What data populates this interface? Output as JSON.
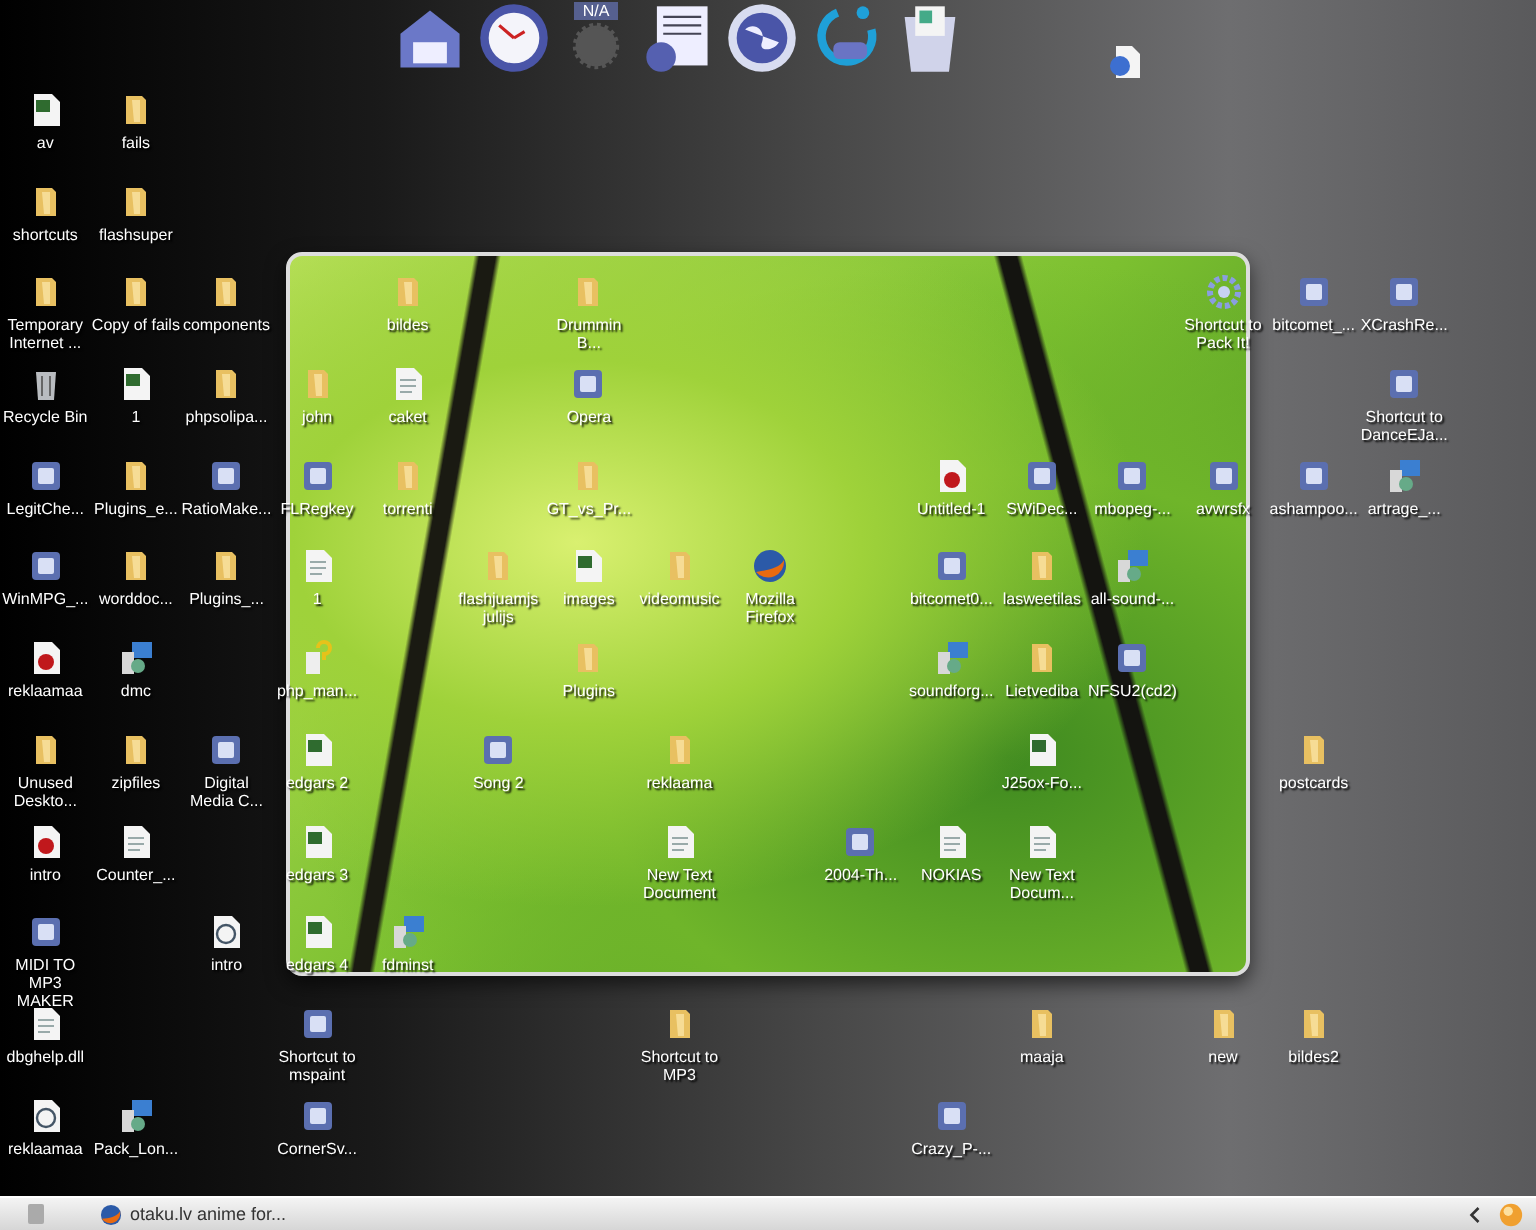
{
  "dock": {
    "badge": "N/A"
  },
  "icons": [
    {
      "label": "av",
      "kind": "sheet"
    },
    {
      "label": "fails",
      "kind": "folder"
    },
    {
      "label": "shortcuts",
      "kind": "folder"
    },
    {
      "label": "flashsuper",
      "kind": "folder"
    },
    {
      "label": "Temporary Internet ...",
      "kind": "folder"
    },
    {
      "label": "Copy of fails",
      "kind": "folder"
    },
    {
      "label": "components",
      "kind": "folder"
    },
    {
      "label": "bildes",
      "kind": "folder"
    },
    {
      "label": "Drummin B...",
      "kind": "folder"
    },
    {
      "label": "Shortcut to Pack It!",
      "kind": "gear"
    },
    {
      "label": "bitcomet_...",
      "kind": "program"
    },
    {
      "label": "XCrashRe...",
      "kind": "program"
    },
    {
      "label": "Recycle Bin",
      "kind": "recycle"
    },
    {
      "label": "1",
      "kind": "sheet"
    },
    {
      "label": "phpsolipa...",
      "kind": "folder"
    },
    {
      "label": "john",
      "kind": "folder"
    },
    {
      "label": "caket",
      "kind": "document"
    },
    {
      "label": "Opera",
      "kind": "program"
    },
    {
      "label": "Shortcut to DanceEJa...",
      "kind": "program"
    },
    {
      "label": "LegitChe...",
      "kind": "program"
    },
    {
      "label": "Plugins_e...",
      "kind": "folder"
    },
    {
      "label": "RatioMake...",
      "kind": "program"
    },
    {
      "label": "FLRegkey",
      "kind": "program"
    },
    {
      "label": "torrenti",
      "kind": "folder"
    },
    {
      "label": "GT_vs_Pr...",
      "kind": "folder"
    },
    {
      "label": "Untitled-1",
      "kind": "media"
    },
    {
      "label": "SWiDec...",
      "kind": "program"
    },
    {
      "label": "mbopeg-...",
      "kind": "program"
    },
    {
      "label": "avwrsfx",
      "kind": "program"
    },
    {
      "label": "ashampoo...",
      "kind": "program"
    },
    {
      "label": "artrage_...",
      "kind": "installer"
    },
    {
      "label": "WinMPG_...",
      "kind": "program"
    },
    {
      "label": "worddoc...",
      "kind": "folder"
    },
    {
      "label": "Plugins_...",
      "kind": "folder"
    },
    {
      "label": "1",
      "kind": "document"
    },
    {
      "label": "flashjuamjs julijs",
      "kind": "folder"
    },
    {
      "label": "images",
      "kind": "sheet"
    },
    {
      "label": "videomusic",
      "kind": "folder"
    },
    {
      "label": "Mozilla Firefox",
      "kind": "browser"
    },
    {
      "label": "bitcomet0...",
      "kind": "program"
    },
    {
      "label": "lasweetilas",
      "kind": "folder"
    },
    {
      "label": "all-sound-...",
      "kind": "installer"
    },
    {
      "label": "reklaamaa",
      "kind": "media"
    },
    {
      "label": "dmc",
      "kind": "installer"
    },
    {
      "label": "php_man...",
      "kind": "help"
    },
    {
      "label": "Plugins",
      "kind": "folder"
    },
    {
      "label": "soundforg...",
      "kind": "installer"
    },
    {
      "label": "Lietvediba",
      "kind": "folder"
    },
    {
      "label": "NFSU2(cd2)",
      "kind": "program"
    },
    {
      "label": "Unused Deskto...",
      "kind": "folder"
    },
    {
      "label": "zipfiles",
      "kind": "folder"
    },
    {
      "label": "Digital Media C...",
      "kind": "program"
    },
    {
      "label": "edgars 2",
      "kind": "sheet"
    },
    {
      "label": "Song 2",
      "kind": "program"
    },
    {
      "label": "reklaama",
      "kind": "folder"
    },
    {
      "label": "J25ox-Fo...",
      "kind": "sheet"
    },
    {
      "label": "postcards",
      "kind": "folder"
    },
    {
      "label": "intro",
      "kind": "media"
    },
    {
      "label": "Counter_...",
      "kind": "document"
    },
    {
      "label": "edgars 3",
      "kind": "sheet"
    },
    {
      "label": "New Text Document",
      "kind": "document"
    },
    {
      "label": "2004-Th...",
      "kind": "program"
    },
    {
      "label": "NOKIAS",
      "kind": "document"
    },
    {
      "label": "New Text Docum...",
      "kind": "document"
    },
    {
      "label": "MIDI TO MP3 MAKER",
      "kind": "program"
    },
    {
      "label": "intro",
      "kind": "audio"
    },
    {
      "label": "edgars 4",
      "kind": "sheet"
    },
    {
      "label": "fdminst",
      "kind": "installer"
    },
    {
      "label": "dbghelp.dll",
      "kind": "document"
    },
    {
      "label": "Shortcut to mspaint",
      "kind": "program"
    },
    {
      "label": "Shortcut to MP3",
      "kind": "folder"
    },
    {
      "label": "maaja",
      "kind": "folder"
    },
    {
      "label": "new",
      "kind": "folder"
    },
    {
      "label": "bildes2",
      "kind": "folder"
    },
    {
      "label": "reklaamaa",
      "kind": "audio"
    },
    {
      "label": "Pack_Lon...",
      "kind": "installer"
    },
    {
      "label": "CornerSv...",
      "kind": "program"
    },
    {
      "label": "Crazy_P-...",
      "kind": "program"
    }
  ],
  "taskbar": {
    "tasks": [
      {
        "label": "otaku.lv anime for..."
      }
    ]
  }
}
